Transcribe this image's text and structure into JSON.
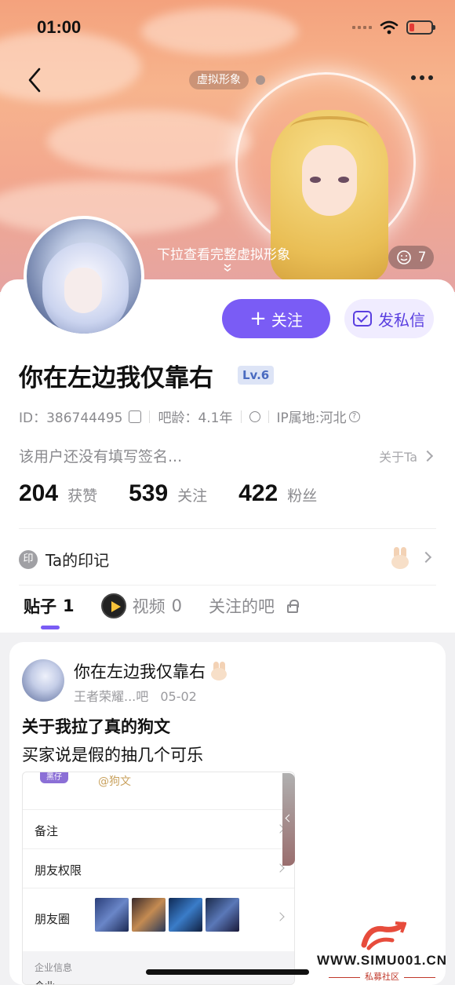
{
  "status_bar": {
    "time": "01:00"
  },
  "hero": {
    "avatar_tag": "虚拟形象",
    "pull_hint": "下拉查看完整虚拟形象",
    "like_count": "7"
  },
  "actions": {
    "follow_label": "关注",
    "message_label": "发私信"
  },
  "profile": {
    "username": "你在左边我仅靠右",
    "level": "Lv.6",
    "id_text": "ID：386744495",
    "age_text": "吧龄：4.1年",
    "ip_text": "IP属地:河北",
    "bio": "该用户还没有填写签名...",
    "about_link": "关于Ta"
  },
  "stats": [
    {
      "value": "204",
      "label": "获赞"
    },
    {
      "value": "539",
      "label": "关注"
    },
    {
      "value": "422",
      "label": "粉丝"
    }
  ],
  "imprint": {
    "icon_text": "印",
    "label": "Ta的印记"
  },
  "tabs": [
    {
      "label": "贴子",
      "count": "1"
    },
    {
      "label": "视频",
      "count": "0"
    },
    {
      "label": "关注的吧"
    }
  ],
  "post": {
    "author": "你在左边我仅靠右",
    "forum": "王者荣耀...吧",
    "date": "05-02",
    "title": "关于我拉了真的狗文",
    "body": "买家说是假的抽几个可乐",
    "screenshot": {
      "tag": "黑仔",
      "mention": "@狗文",
      "rows": [
        "备注",
        "朋友权限",
        "朋友圈"
      ],
      "section": "企业信息",
      "bottom": "企业"
    }
  },
  "watermark": {
    "site": "WWW.SIMU001.CN",
    "sub": "私募社区"
  },
  "colors": {
    "accent": "#7a5cf5",
    "accent_light": "#f0ecff",
    "muted_text": "#8a8a8e"
  }
}
